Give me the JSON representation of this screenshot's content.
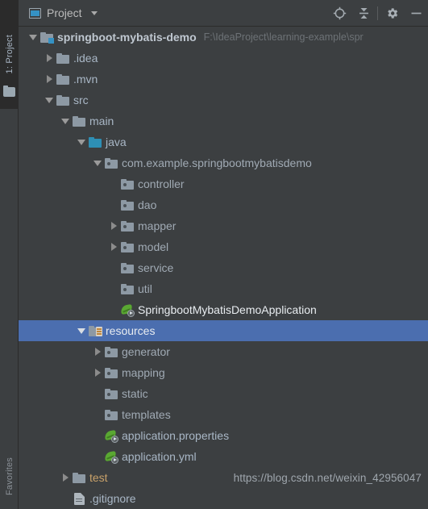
{
  "window": {
    "tool_strip": {
      "top_tab_label": "1: Project",
      "bottom_tab_label": "Favorites",
      "top_tab_icon": "folder-icon"
    },
    "toolbar": {
      "tab_label": "Project",
      "tab_icon": "project-window-icon",
      "dropdown_icon": "chevron-down-icon",
      "buttons": [
        {
          "name": "locate-icon",
          "title": "Select Opened File"
        },
        {
          "name": "collapse-all-icon",
          "title": "Collapse All"
        },
        {
          "name": "gear-icon",
          "title": "Settings"
        },
        {
          "name": "minimize-icon",
          "title": "Hide"
        }
      ]
    }
  },
  "colors": {
    "background": "#3c3f41",
    "selection": "#4b6eaf",
    "text": "#a9b7c6",
    "muted_text": "#6d7276",
    "accent_blue": "#3592c4",
    "source_root": "#2e8fb5",
    "spring_green": "#5aa832",
    "test_root": "#c9a26a"
  },
  "watermark": "https://blog.csdn.net/weixin_42956047",
  "tree": {
    "rows": [
      {
        "label": "springboot-mybatis-demo",
        "sub": "F:\\IdeaProject\\learning-example\\spr",
        "indent": 0,
        "twisty": "down",
        "icon": "project-folder-icon",
        "style": "bold",
        "selected": false
      },
      {
        "label": ".idea",
        "sub": "",
        "indent": 1,
        "twisty": "right",
        "icon": "folder-icon",
        "style": "plain",
        "selected": false
      },
      {
        "label": ".mvn",
        "sub": "",
        "indent": 1,
        "twisty": "right",
        "icon": "folder-icon",
        "style": "plain",
        "selected": false
      },
      {
        "label": "src",
        "sub": "",
        "indent": 1,
        "twisty": "down",
        "icon": "folder-icon",
        "style": "plain",
        "selected": false
      },
      {
        "label": "main",
        "sub": "",
        "indent": 2,
        "twisty": "down",
        "icon": "folder-icon",
        "style": "plain",
        "selected": false
      },
      {
        "label": "java",
        "sub": "",
        "indent": 3,
        "twisty": "down",
        "icon": "source-root-icon",
        "style": "plain",
        "selected": false
      },
      {
        "label": "com.example.springbootmybatisdemo",
        "sub": "",
        "indent": 4,
        "twisty": "down",
        "icon": "package-icon",
        "style": "pkg",
        "selected": false
      },
      {
        "label": "controller",
        "sub": "",
        "indent": 5,
        "twisty": "none",
        "icon": "package-icon",
        "style": "pkg",
        "selected": false
      },
      {
        "label": "dao",
        "sub": "",
        "indent": 5,
        "twisty": "none",
        "icon": "package-icon",
        "style": "pkg",
        "selected": false
      },
      {
        "label": "mapper",
        "sub": "",
        "indent": 5,
        "twisty": "right",
        "icon": "package-icon",
        "style": "pkg",
        "selected": false
      },
      {
        "label": "model",
        "sub": "",
        "indent": 5,
        "twisty": "right",
        "icon": "package-icon",
        "style": "pkg",
        "selected": false
      },
      {
        "label": "service",
        "sub": "",
        "indent": 5,
        "twisty": "none",
        "icon": "package-icon",
        "style": "pkg",
        "selected": false
      },
      {
        "label": "util",
        "sub": "",
        "indent": 5,
        "twisty": "none",
        "icon": "package-icon",
        "style": "pkg",
        "selected": false
      },
      {
        "label": "SpringbootMybatisDemoApplication",
        "sub": "",
        "indent": 5,
        "twisty": "none",
        "icon": "spring-boot-class-icon",
        "style": "white",
        "selected": false
      },
      {
        "label": "resources",
        "sub": "",
        "indent": 3,
        "twisty": "down",
        "icon": "resource-root-icon",
        "style": "white",
        "selected": true
      },
      {
        "label": "generator",
        "sub": "",
        "indent": 4,
        "twisty": "right",
        "icon": "package-icon",
        "style": "pkg",
        "selected": false
      },
      {
        "label": "mapping",
        "sub": "",
        "indent": 4,
        "twisty": "right",
        "icon": "package-icon",
        "style": "pkg",
        "selected": false
      },
      {
        "label": "static",
        "sub": "",
        "indent": 4,
        "twisty": "none",
        "icon": "package-icon",
        "style": "pkg",
        "selected": false
      },
      {
        "label": "templates",
        "sub": "",
        "indent": 4,
        "twisty": "none",
        "icon": "package-icon",
        "style": "pkg",
        "selected": false
      },
      {
        "label": "application.properties",
        "sub": "",
        "indent": 4,
        "twisty": "none",
        "icon": "spring-config-icon",
        "style": "plain",
        "selected": false
      },
      {
        "label": "application.yml",
        "sub": "",
        "indent": 4,
        "twisty": "none",
        "icon": "spring-config-icon",
        "style": "plain",
        "selected": false
      },
      {
        "label": "test",
        "sub": "",
        "indent": 2,
        "twisty": "right",
        "icon": "folder-icon",
        "style": "test",
        "selected": false
      },
      {
        "label": ".gitignore",
        "sub": "",
        "indent": 2,
        "twisty": "none",
        "icon": "file-icon",
        "style": "plain",
        "selected": false
      }
    ]
  }
}
